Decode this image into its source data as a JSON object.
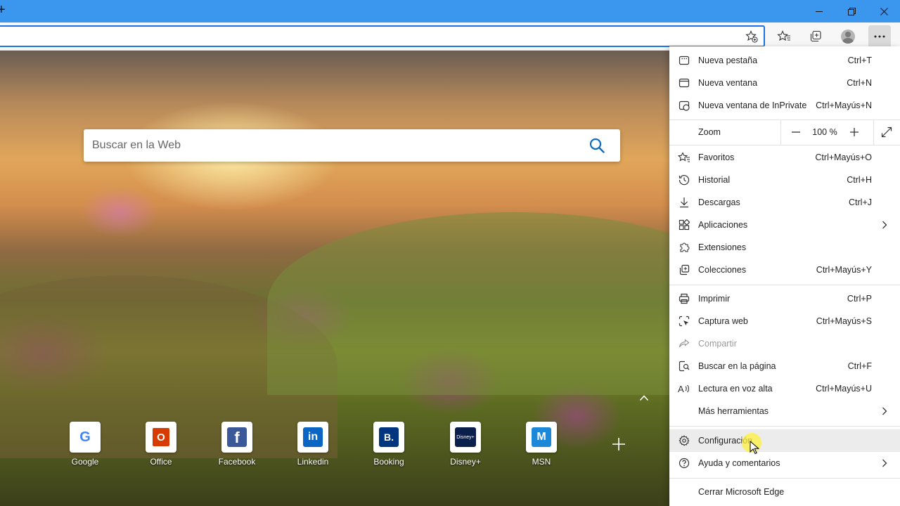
{
  "window": {
    "new_tab_glyph": "+",
    "controls": [
      "minimize-icon",
      "restore-icon",
      "close-icon"
    ]
  },
  "toolbar": {
    "icons": [
      "add-favorite-star-icon",
      "favorites-icon",
      "collections-icon",
      "profile-avatar",
      "settings-more-icon"
    ]
  },
  "ntp": {
    "search_placeholder": "Buscar en la Web",
    "quick_links": [
      {
        "label": "Google",
        "glyph": "G",
        "color": "#4285f4",
        "bg": "#ffffff"
      },
      {
        "label": "Office",
        "glyph": "O",
        "color": "#ffffff",
        "bg": "#d83b01"
      },
      {
        "label": "Facebook",
        "glyph": "f",
        "color": "#ffffff",
        "bg": "#3b5998"
      },
      {
        "label": "Linkedin",
        "glyph": "in",
        "color": "#ffffff",
        "bg": "#0a66c2"
      },
      {
        "label": "Booking",
        "glyph": "B.",
        "color": "#ffffff",
        "bg": "#003580"
      },
      {
        "label": "Disney+",
        "glyph": "Disney+",
        "color": "#ffffff",
        "bg": "#0b1f4d"
      },
      {
        "label": "MSN",
        "glyph": "M",
        "color": "#ffffff",
        "bg": "#1e88d8"
      }
    ],
    "add_glyph": "+"
  },
  "menu": {
    "items": [
      {
        "label": "Nueva pestaña",
        "shortcut": "Ctrl+T",
        "icon": "new-tab-icon"
      },
      {
        "label": "Nueva ventana",
        "shortcut": "Ctrl+N",
        "icon": "new-window-icon"
      },
      {
        "label": "Nueva ventana de InPrivate",
        "shortcut": "Ctrl+Mayús+N",
        "icon": "inprivate-icon"
      },
      {
        "label": "Favoritos",
        "shortcut": "Ctrl+Mayús+O",
        "icon": "favorites-icon"
      },
      {
        "label": "Historial",
        "shortcut": "Ctrl+H",
        "icon": "history-icon"
      },
      {
        "label": "Descargas",
        "shortcut": "Ctrl+J",
        "icon": "download-icon"
      },
      {
        "label": "Aplicaciones",
        "shortcut": "",
        "icon": "apps-icon"
      },
      {
        "label": "Extensiones",
        "shortcut": "",
        "icon": "extensions-icon"
      },
      {
        "label": "Colecciones",
        "shortcut": "Ctrl+Mayús+Y",
        "icon": "collections-icon"
      },
      {
        "label": "Imprimir",
        "shortcut": "Ctrl+P",
        "icon": "print-icon"
      },
      {
        "label": "Captura web",
        "shortcut": "Ctrl+Mayús+S",
        "icon": "web-capture-icon"
      },
      {
        "label": "Compartir",
        "shortcut": "",
        "icon": "share-icon"
      },
      {
        "label": "Buscar en la página",
        "shortcut": "Ctrl+F",
        "icon": "find-icon"
      },
      {
        "label": "Lectura en voz alta",
        "shortcut": "Ctrl+Mayús+U",
        "icon": "read-aloud-icon"
      },
      {
        "label": "Más herramientas",
        "shortcut": "",
        "icon": ""
      },
      {
        "label": "Configuración",
        "shortcut": "",
        "icon": "gear-icon"
      },
      {
        "label": "Ayuda y comentarios",
        "shortcut": "",
        "icon": "help-icon"
      },
      {
        "label": "Cerrar Microsoft Edge",
        "shortcut": "",
        "icon": ""
      }
    ],
    "zoom": {
      "label": "Zoom",
      "value": "100 %",
      "minus": "—",
      "plus": "+"
    }
  }
}
